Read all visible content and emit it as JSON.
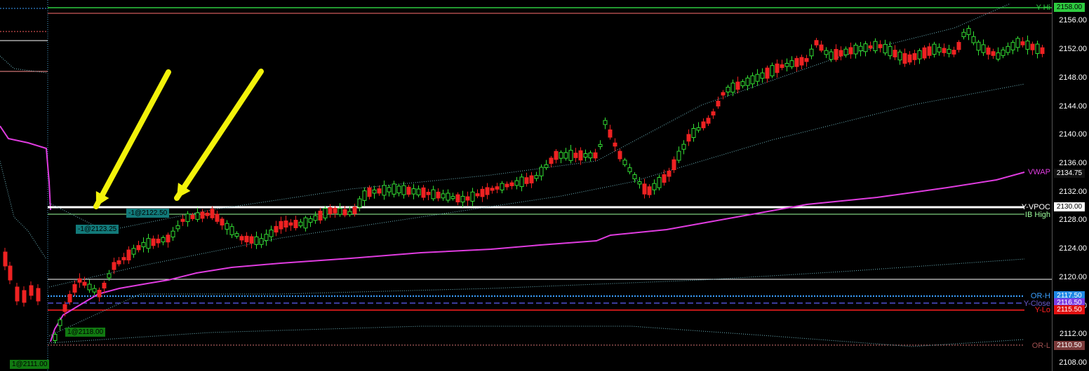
{
  "axis": {
    "min": 2108,
    "max": 2160,
    "ticks": [
      "2108.00",
      "2112.00",
      "2116.00",
      "2120.00",
      "2124.00",
      "2128.00",
      "2132.00",
      "2136.00",
      "2140.00",
      "2144.00",
      "2148.00",
      "2152.00",
      "2156.00"
    ]
  },
  "levels": {
    "y_hi": {
      "label": "Y-Hi",
      "value": 2158.0,
      "price": "2158.00",
      "color": "#2ecc40"
    },
    "y_vpoc": {
      "label": "Y-VPOC",
      "value": 2130.0,
      "price": "2130.00",
      "color": "#ffffff"
    },
    "ib_high": {
      "label": "IB High",
      "value": 2129.0,
      "color": "#9dff9d"
    },
    "vwap": {
      "label": "VWAP",
      "price": "2134.75",
      "color": "#e03ce0"
    },
    "or_h": {
      "label": "OR-H",
      "value": 2117.5,
      "price": "2117.50",
      "color": "#3aa0ff"
    },
    "y_close": {
      "label": "Y-Close",
      "value": 2116.5,
      "price": "2116.50",
      "color": "#6a5acd"
    },
    "y_lo": {
      "label": "Y-Lo",
      "value": 2115.5,
      "price": "2115.50",
      "color": "#ff2020"
    },
    "or_l": {
      "label": "OR-L",
      "value": 2110.5,
      "price": "2110.50",
      "color": "#a05050"
    }
  },
  "trades": {
    "t1": "-1@2122.50",
    "t2": "-1@2123.25",
    "t3": "1@2118.00",
    "t4": "1@2111.00"
  },
  "colors": {
    "up": "#33dd33",
    "down": "#ee2222",
    "band": "#6fb6c0",
    "arrow": "#f2f20a"
  }
}
